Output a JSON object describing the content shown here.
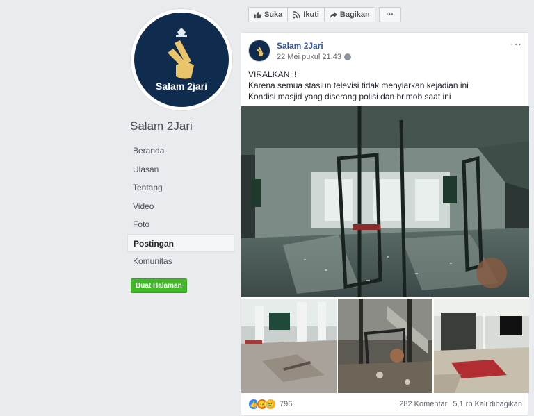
{
  "page": {
    "name": "Salam 2Jari",
    "logo_text": "Salam 2jari"
  },
  "sidebar": {
    "items": [
      {
        "label": "Beranda"
      },
      {
        "label": "Ulasan"
      },
      {
        "label": "Tentang"
      },
      {
        "label": "Video"
      },
      {
        "label": "Foto"
      },
      {
        "label": "Postingan"
      },
      {
        "label": "Komunitas"
      }
    ],
    "active_index": 5,
    "create_page_label": "Buat Halaman"
  },
  "actions": {
    "like": "Suka",
    "follow": "Ikuti",
    "share": "Bagikan",
    "more": "···"
  },
  "post": {
    "author": "Salam 2Jari",
    "timestamp": "22 Mei pukul 21.43",
    "menu": "···",
    "lines": [
      "VIRALKAN !!",
      "Karena semua stasiun televisi tidak menyiarkan kejadian ini",
      "Kondisi masjid yang diserang polisi dan brimob saat ini"
    ],
    "reaction_count": "796",
    "comments": "282 Komentar",
    "shares": "5,1 rb Kali dibagikan"
  },
  "colors": {
    "brand_blue": "#365899",
    "logo_navy": "#0f2c4e",
    "logo_gold": "#e9c46a",
    "create_green": "#42b72a"
  }
}
